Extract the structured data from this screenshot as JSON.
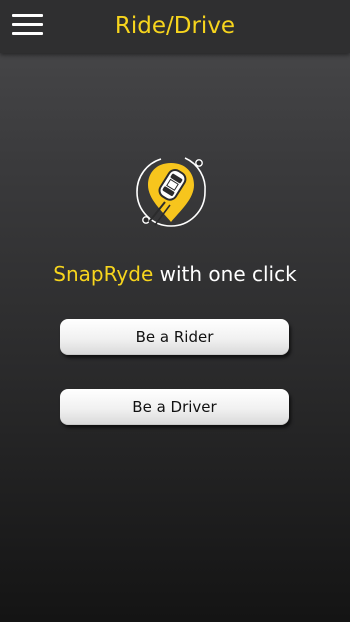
{
  "header": {
    "title": "Ride/Drive",
    "menu_icon": "hamburger-menu-icon"
  },
  "logo": {
    "icon": "location-pin-car-icon",
    "colors": {
      "pin": "#f7c51d",
      "ring": "#ffffff",
      "car": "#ffffff"
    }
  },
  "tagline": {
    "brand": "SnapRyde",
    "rest": " with one click"
  },
  "actions": {
    "rider_label": "Be a Rider",
    "driver_label": "Be a Driver"
  },
  "colors": {
    "accent": "#f7d51d",
    "header_bg": "#2f2f30",
    "background_top": "#4a4a4c",
    "background_bottom": "#141414",
    "button_text": "#111111"
  }
}
